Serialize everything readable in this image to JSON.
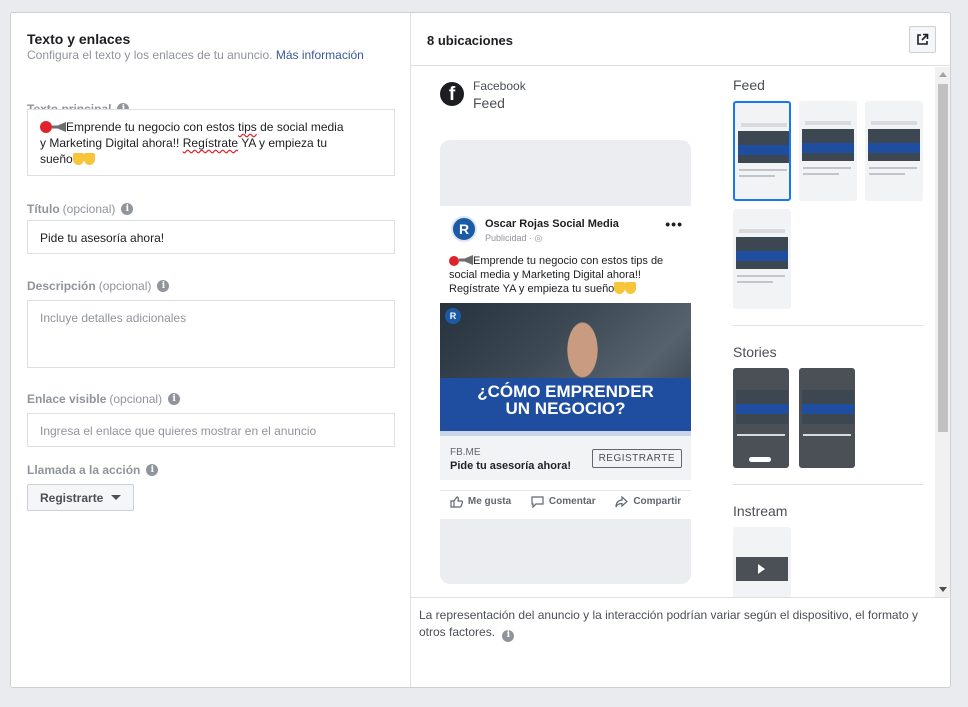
{
  "left": {
    "title": "Texto y enlaces",
    "subtitle": "Configura el texto y los enlaces de tu anuncio.",
    "learn_more": "Más información",
    "primary_text": {
      "label": "Texto principal",
      "line1": "Emprende tu negocio con estos ",
      "tips": "tips",
      "line1b": " de social media",
      "line2a": "y Marketing Digital ahora!! ",
      "registrate": "Regístrate",
      "line2b": " YA y empieza tu",
      "line3": "sueño"
    },
    "headline": {
      "label": "Título",
      "optional": "(opcional)",
      "value": "Pide tu asesoría ahora!"
    },
    "description": {
      "label": "Descripción",
      "optional": "(opcional)",
      "placeholder": "Incluye detalles adicionales"
    },
    "display_link": {
      "label": "Enlace visible",
      "optional": "(opcional)",
      "placeholder": "Ingresa el enlace que quieres mostrar en el anuncio"
    },
    "cta": {
      "label": "Llamada a la acción",
      "value": "Registrarte"
    }
  },
  "right": {
    "header_title": "8 ubicaciones",
    "platform": "Facebook",
    "position": "Feed",
    "post": {
      "page_name": "Oscar Rojas Social Media",
      "sponsored": "Publicidad · ",
      "text": "Emprende tu negocio con estos tips de social media y Marketing Digital ahora!! Regístrate YA y empieza tu sueño",
      "headline_1": "¿CÓMO EMPRENDER",
      "headline_2": "UN NEGOCIO?",
      "domain": "FB.ME",
      "link_headline": "Pide tu asesoría ahora!",
      "cta": "REGISTRARTE",
      "like": "Me gusta",
      "comment": "Comentar",
      "share": "Compartir"
    },
    "groups": {
      "feed": "Feed",
      "stories": "Stories",
      "instream": "Instream"
    },
    "footer": "La representación del anuncio y la interacción podrían variar según el dispositivo, el formato y otros factores."
  }
}
